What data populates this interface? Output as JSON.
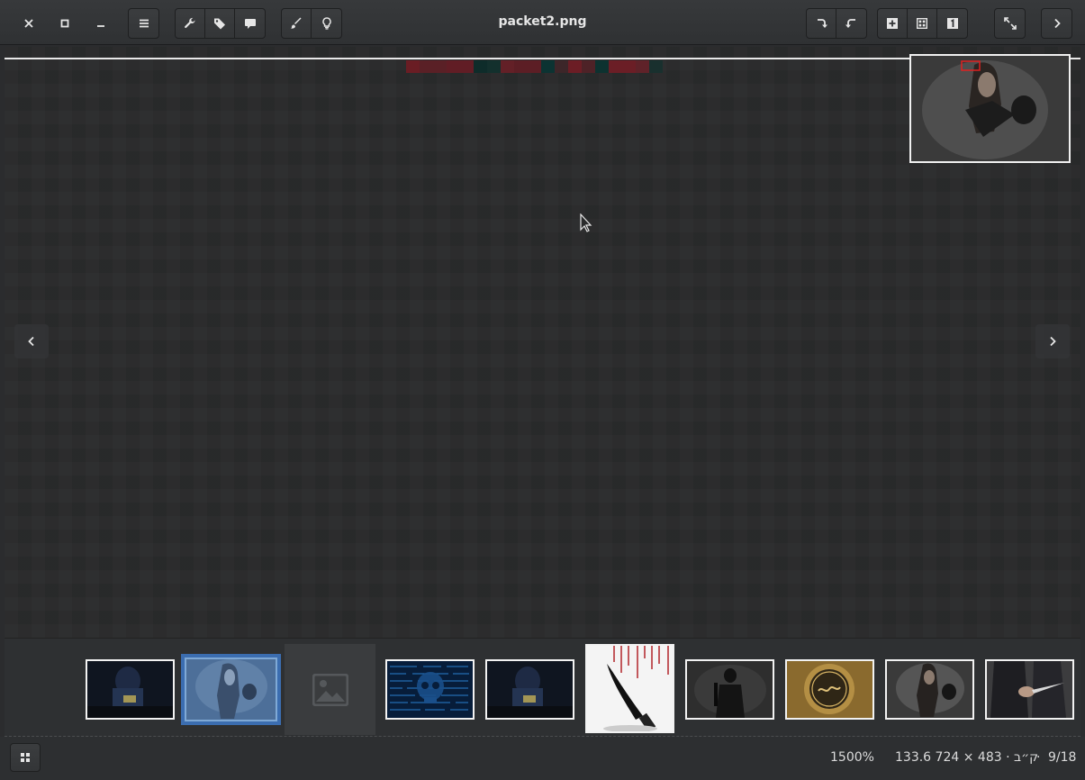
{
  "window": {
    "title": "packet2.png"
  },
  "header": {
    "close_icon": "close-icon",
    "maximize_icon": "maximize-icon",
    "minimize_icon": "minimize-icon",
    "menu_icon": "hamburger-menu-icon",
    "tools": [
      "wrench-icon",
      "tag-icon",
      "comment-icon"
    ],
    "edit": [
      "brush-icon",
      "lightbulb-icon"
    ],
    "rotate": [
      "rotate-right-icon",
      "rotate-left-icon"
    ],
    "zoom": [
      "zoom-in-icon",
      "fit-grid-icon",
      "original-size-icon"
    ],
    "fullscreen_icon": "fullscreen-icon",
    "next_icon": "chevron-right-icon"
  },
  "viewer": {
    "prev_icon": "chevron-left-icon",
    "next_icon": "chevron-right-icon"
  },
  "status": {
    "zoom": "1500%",
    "info": "133.6 ק״ב · 483 × 724",
    "position": "9/18",
    "separator": "·"
  },
  "thumbnails": [
    {
      "id": "hacker-coins",
      "selected": false
    },
    {
      "id": "woman-gun",
      "selected": true
    },
    {
      "id": "placeholder",
      "selected": false
    },
    {
      "id": "skull-code",
      "selected": false
    },
    {
      "id": "hacker-coins-2",
      "selected": false
    },
    {
      "id": "bloody-knife",
      "selected": false
    },
    {
      "id": "masked-rifle",
      "selected": false
    },
    {
      "id": "golden-seal",
      "selected": false
    },
    {
      "id": "woman-gun-2",
      "selected": false
    },
    {
      "id": "hand-knife",
      "selected": false
    }
  ],
  "colors": {
    "selection": "#3b6db0",
    "minimap_frame": "#e02020"
  }
}
